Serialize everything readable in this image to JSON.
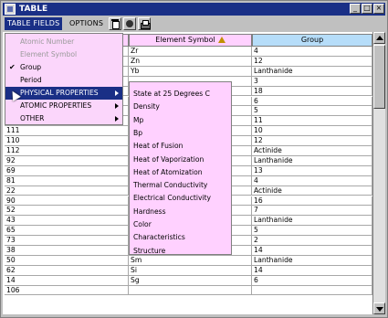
{
  "window": {
    "title": "TABLE",
    "buttons": [
      "_",
      "□",
      "×"
    ]
  },
  "toolbar": {
    "table_fields_label": "TABLE FIELDS",
    "options_label": "OPTIONS"
  },
  "grid": {
    "headers": [
      "",
      "Element Symbol",
      "Group"
    ],
    "sorted_column": "Element Symbol",
    "rows": [
      [
        "",
        "Zr",
        "4"
      ],
      [
        "",
        "Zn",
        "12"
      ],
      [
        "",
        "Yb",
        "Lanthanide"
      ],
      [
        "",
        "",
        "3"
      ],
      [
        "",
        "",
        "18"
      ],
      [
        "",
        "",
        "6"
      ],
      [
        "",
        "",
        "5"
      ],
      [
        "",
        "",
        "11"
      ],
      [
        "111",
        "",
        "10"
      ],
      [
        "110",
        "",
        "12"
      ],
      [
        "112",
        "",
        "Actinide"
      ],
      [
        "92",
        "",
        "Lanthanide"
      ],
      [
        "69",
        "",
        "13"
      ],
      [
        "81",
        "",
        "4"
      ],
      [
        "22",
        "",
        "Actinide"
      ],
      [
        "90",
        "",
        "16"
      ],
      [
        "52",
        "",
        "7"
      ],
      [
        "43",
        "",
        "Lanthanide"
      ],
      [
        "65",
        "",
        "5"
      ],
      [
        "73",
        "Sr",
        "2"
      ],
      [
        "38",
        "Sn",
        "14"
      ],
      [
        "50",
        "Sm",
        "Lanthanide"
      ],
      [
        "62",
        "Si",
        "14"
      ],
      [
        "14",
        "Sg",
        "6"
      ],
      [
        "106",
        "",
        ""
      ]
    ]
  },
  "table_fields_menu": {
    "items": [
      {
        "label": "Atomic Number",
        "disabled": true,
        "checked": false,
        "submenu": false
      },
      {
        "label": "Element Symbol",
        "disabled": true,
        "checked": false,
        "submenu": false
      },
      {
        "label": "Group",
        "disabled": false,
        "checked": true,
        "submenu": false
      },
      {
        "label": "Period",
        "disabled": false,
        "checked": false,
        "submenu": false
      },
      {
        "label": "PHYSICAL PROPERTIES",
        "disabled": false,
        "checked": false,
        "submenu": true,
        "highlighted": true
      },
      {
        "label": "ATOMIC PROPERTIES",
        "disabled": false,
        "checked": false,
        "submenu": true
      },
      {
        "label": "OTHER",
        "disabled": false,
        "checked": false,
        "submenu": true
      }
    ]
  },
  "physical_properties_menu": {
    "items": [
      "State at 25 Degrees C",
      "Density",
      "Mp",
      "Bp",
      "Heat of Fusion",
      "Heat of Vaporization",
      "Heat of Atomization",
      "Thermal Conductivity",
      "Electrical Conductivity",
      "Hardness",
      "Color",
      "Characteristics",
      "Structure"
    ]
  },
  "icons": {
    "app": "table-app-icon",
    "trash": "trash-icon",
    "chem": "chemistry-icon",
    "print": "print-icon"
  },
  "colors": {
    "titlebar": "#1a2f86",
    "header_pink": "#ffd1ff",
    "header_blue": "#b6ddf9",
    "menu_pink": "#fbd6fb"
  }
}
